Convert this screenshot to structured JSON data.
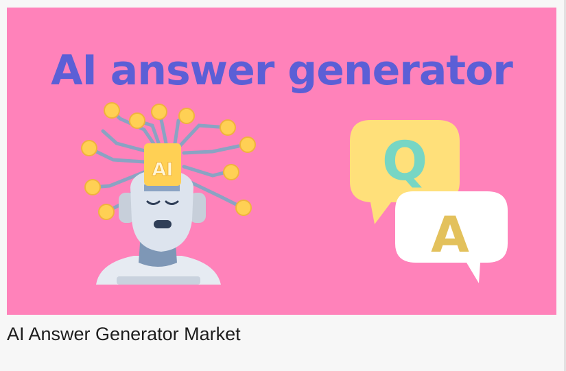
{
  "banner": {
    "title": "AI answer generator",
    "robot_chip_text": "AI",
    "question_letter": "Q",
    "answer_letter": "A"
  },
  "caption": "AI Answer Generator Market",
  "colors": {
    "banner_background": "#ff82ba",
    "title": "#5b5fd6",
    "chip": "#ffd054",
    "question_bubble": "#ffe07a",
    "question_letter": "#77d6c4",
    "answer_bubble": "#ffffff",
    "answer_letter": "#e3c15c"
  },
  "icons": [
    "robot-head-icon",
    "question-speech-bubble-icon",
    "answer-speech-bubble-icon"
  ]
}
